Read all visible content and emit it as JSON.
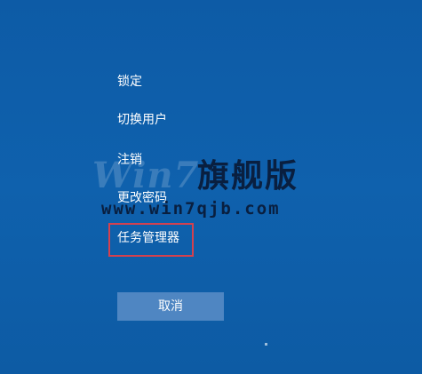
{
  "menu": {
    "items": [
      {
        "label": "锁定"
      },
      {
        "label": "切换用户"
      },
      {
        "label": "注销"
      },
      {
        "label": "更改密码"
      },
      {
        "label": "任务管理器"
      }
    ]
  },
  "cancel_label": "取消",
  "highlight": {
    "color": "#d4414f",
    "target": "任务管理器"
  },
  "background_color": "#0f5ea8",
  "watermark": {
    "brand": "Win7",
    "brand_cn": "旗舰版",
    "url": "www.win7qjb.com"
  }
}
